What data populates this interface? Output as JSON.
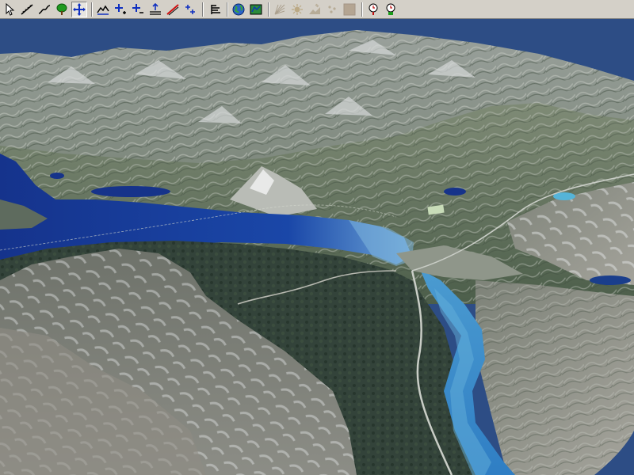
{
  "app": {
    "window_background": "#d4d0c8",
    "sky_color": "#2d4d85"
  },
  "toolbar": {
    "buttons": [
      {
        "id": "select",
        "icon": "arrow-pointer-icon",
        "active": false
      },
      {
        "id": "measure-distance",
        "icon": "ruler-line-icon",
        "active": false
      },
      {
        "id": "profile",
        "icon": "profile-curve-icon",
        "active": false
      },
      {
        "id": "vegetation",
        "icon": "tree-icon",
        "active": false
      },
      {
        "id": "pan",
        "icon": "move-cross-icon",
        "active": true
      },
      {
        "id": "terrain",
        "icon": "terrain-surface-icon",
        "active": false
      },
      {
        "id": "zoom-in",
        "icon": "zoom-in-plus-icon",
        "active": false
      },
      {
        "id": "zoom-out",
        "icon": "zoom-out-minus-icon",
        "active": false
      },
      {
        "id": "raise-surface",
        "icon": "raise-plane-icon",
        "active": false
      },
      {
        "id": "draw-line",
        "icon": "red-line-icon",
        "active": false
      },
      {
        "id": "spread-points",
        "icon": "scatter-points-icon",
        "active": false
      },
      {
        "id": "layers",
        "icon": "layers-stack-icon",
        "active": false
      },
      {
        "id": "globe-view",
        "icon": "globe-icon",
        "active": false
      },
      {
        "id": "map-view",
        "icon": "map-icon",
        "active": false
      },
      {
        "id": "sun-rays",
        "icon": "sun-rays-icon",
        "active": false,
        "disabled": true
      },
      {
        "id": "light-source",
        "icon": "light-source-icon",
        "active": false,
        "disabled": true
      },
      {
        "id": "fly-over",
        "icon": "flyover-icon",
        "active": false,
        "disabled": true
      },
      {
        "id": "points",
        "icon": "dots-icon",
        "active": false,
        "disabled": true
      },
      {
        "id": "texture",
        "icon": "texture-square-icon",
        "active": false,
        "disabled": true
      },
      {
        "id": "stop-animation",
        "icon": "stopwatch-red-icon",
        "active": false
      },
      {
        "id": "start-animation",
        "icon": "stopwatch-green-icon",
        "active": false
      }
    ]
  },
  "scene": {
    "description_colors": {
      "lake_deep": "#16378f",
      "lake_shallow": "#3c8fc7",
      "forest_dark": "#2d3d33",
      "mountain_light": "#9ea29a",
      "snow": "#e6e8ea"
    }
  }
}
